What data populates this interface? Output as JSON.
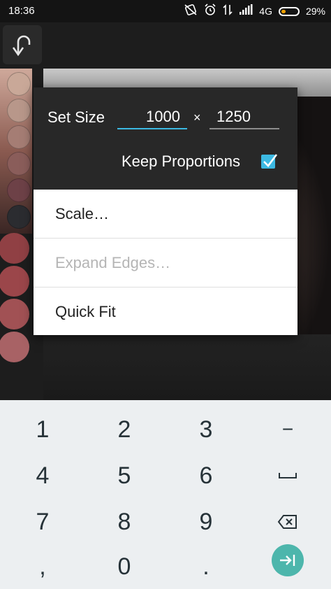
{
  "status_bar": {
    "time": "18:36",
    "network": "4G",
    "battery_percent": "29%",
    "battery_level": 0.29,
    "icons": [
      "screen-rotation-icon",
      "alarm-icon",
      "data-transfer-icon",
      "signal-icon",
      "battery-icon"
    ]
  },
  "toolbar": {
    "undo_icon": "undo-arrow-icon"
  },
  "swatches": {
    "colors": [
      "#c9a898",
      "#b8978a",
      "#a57d74",
      "#8a5d5a",
      "#6d4147",
      "#2b2c30",
      "#a4474b",
      "#b14d52",
      "#b95a5e",
      "#c16e72"
    ]
  },
  "dialog": {
    "set_size_label": "Set Size",
    "width_value": "1000",
    "times_symbol": "×",
    "height_value": "1250",
    "keep_proportions_label": "Keep Proportions",
    "keep_proportions_checked": true,
    "accent_color": "#3cb9e2",
    "menu": [
      {
        "label": "Scale…",
        "enabled": true
      },
      {
        "label": "Expand Edges…",
        "enabled": false
      },
      {
        "label": "Quick Fit",
        "enabled": true
      }
    ]
  },
  "keyboard": {
    "keys": [
      [
        "1",
        "2",
        "3",
        "−"
      ],
      [
        "4",
        "5",
        "6",
        "space"
      ],
      [
        "7",
        "8",
        "9",
        "backspace"
      ],
      [
        ",",
        "0",
        ".",
        "enter"
      ]
    ],
    "row1": [
      "1",
      "2",
      "3",
      "−"
    ],
    "row2": [
      "4",
      "5",
      "6"
    ],
    "row3": [
      "7",
      "8",
      "9"
    ],
    "row4": [
      ",",
      "0",
      "."
    ],
    "enter_color": "#4db6ac"
  }
}
